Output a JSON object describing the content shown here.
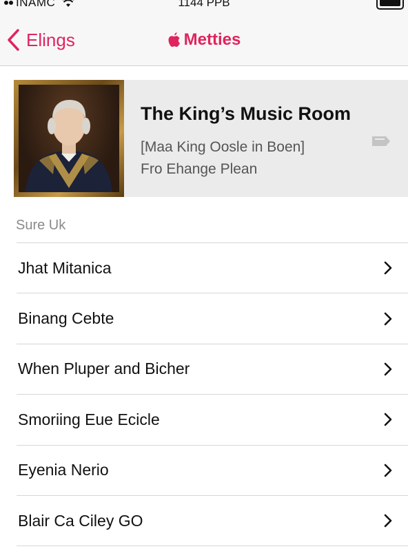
{
  "status_bar": {
    "carrier": "INAMC",
    "time": "1144 PPB"
  },
  "nav": {
    "back_label": "Elings",
    "title": "Metties"
  },
  "hero": {
    "title": "The King’s Music Room",
    "subtitle_1": "[Maa King Oosle in Boen]",
    "subtitle_2": "Fro Ehange Plean"
  },
  "section": {
    "header": "Sure Uk",
    "items": [
      {
        "label": "Jhat Mitanica"
      },
      {
        "label": "Binang Cebte"
      },
      {
        "label": "When Pluper and Bicher"
      },
      {
        "label": "Smoriing Eue Ecicle"
      },
      {
        "label": "Eyenia Nerio"
      },
      {
        "label": "Blair Ca Ciley GO"
      }
    ]
  },
  "colors": {
    "accent": "#e0245e",
    "nav_background": "#f7f7f7",
    "hero_background": "#ebebeb"
  },
  "icons": {
    "back": "chevron-left-icon",
    "brand": "apple-logo-icon",
    "row": "chevron-right-icon",
    "hero_action": "tag-icon"
  }
}
